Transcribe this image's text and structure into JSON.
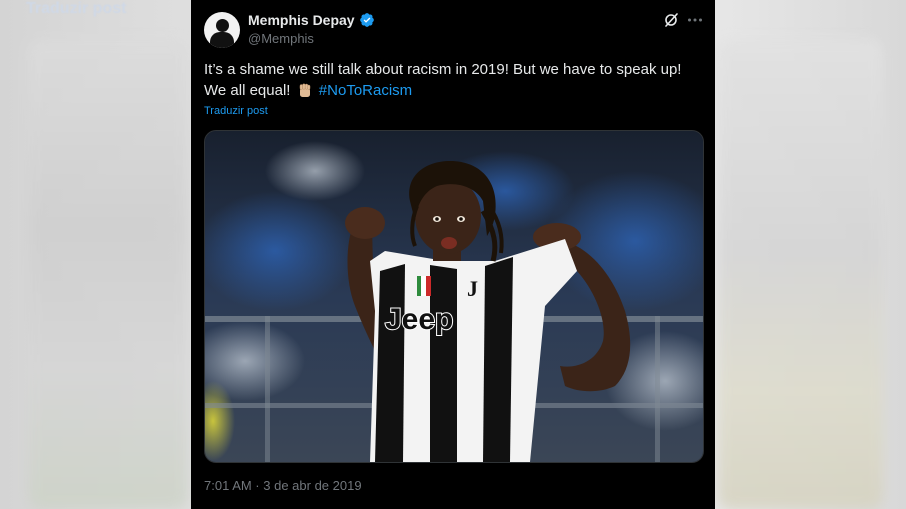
{
  "background": {
    "ghost_text": "Traduzir post"
  },
  "tweet": {
    "author": {
      "display_name": "Memphis Depay",
      "handle": "@Memphis",
      "verified": true
    },
    "text": {
      "line1": "It’s a shame we still talk about racism in 2019! But we have to speak up!",
      "line2_prefix": "We all equal!",
      "hashtag": "#NoToRacism"
    },
    "translate_label": "Traduzir post",
    "media": {
      "jersey_sponsor": "Jeep"
    },
    "timestamp": "7:01 AM · 3 de abr de 2019",
    "icons": {
      "verified": "verified-badge-icon",
      "grok": "grok-icon",
      "more": "more-options-icon",
      "emoji": "raised-fist-emoji"
    },
    "colors": {
      "background": "#000000",
      "text": "#e7e9ea",
      "secondary": "#71767b",
      "link": "#1d9bf0"
    }
  }
}
